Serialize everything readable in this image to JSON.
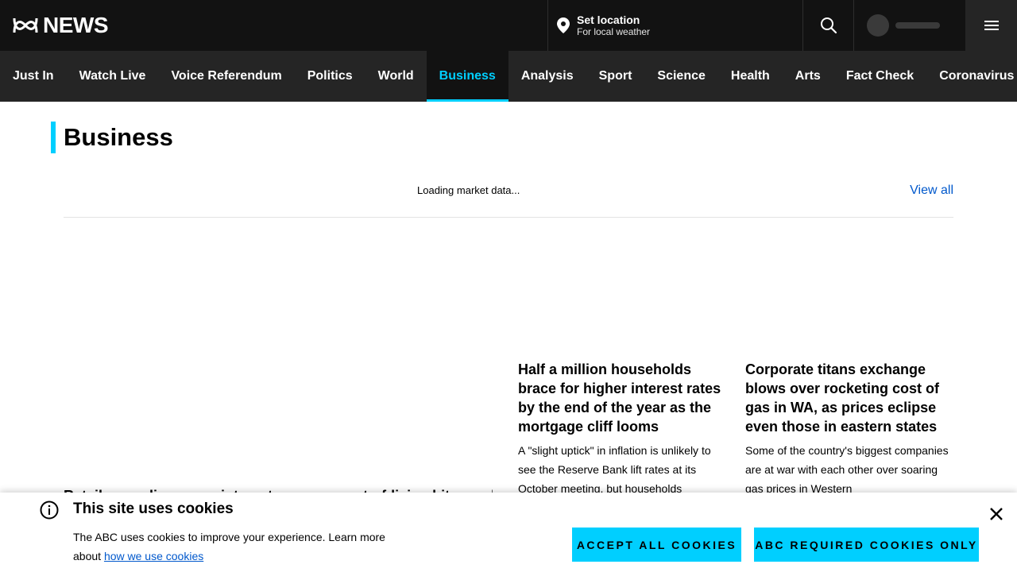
{
  "header": {
    "logo_text": "NEWS",
    "location_title": "Set location",
    "location_subtitle": "For local weather"
  },
  "nav": {
    "items": [
      {
        "label": "Just In"
      },
      {
        "label": "Watch Live"
      },
      {
        "label": "Voice Referendum"
      },
      {
        "label": "Politics"
      },
      {
        "label": "World"
      },
      {
        "label": "Business",
        "active": true
      },
      {
        "label": "Analysis"
      },
      {
        "label": "Sport"
      },
      {
        "label": "Science"
      },
      {
        "label": "Health"
      },
      {
        "label": "Arts"
      },
      {
        "label": "Fact Check"
      },
      {
        "label": "Coronavirus"
      }
    ]
  },
  "page": {
    "title": "Business",
    "market_loading": "Loading market data...",
    "view_all": "View all"
  },
  "stories": [
    {
      "headline": "Half a million households brace for higher interest rates by the end of the year as the mortgage cliff looms",
      "summary": "A \"slight uptick\" in inflation is unlikely to see the Reserve Bank lift rates at its October meeting, but households"
    },
    {
      "headline": "Corporate titans exchange blows over rocketing cost of gas in WA, as prices eclipse even those in eastern states",
      "summary": "Some of the country's biggest companies are at war with each other over soaring gas prices in Western"
    }
  ],
  "lead_story": {
    "headline_fragment": "Retailers, online sugar interests soar as cost-of-living bites and as ASX ult"
  },
  "cookie_banner": {
    "title": "This site uses cookies",
    "text": "The ABC uses cookies to improve your experience. Learn more about ",
    "link": "how we use cookies",
    "accept_all": "Accept all cookies",
    "required_only": "ABC required cookies only"
  },
  "colors": {
    "accent": "#00cfff",
    "topbar": "#121212",
    "nav": "#252525",
    "link": "#0058cc"
  }
}
